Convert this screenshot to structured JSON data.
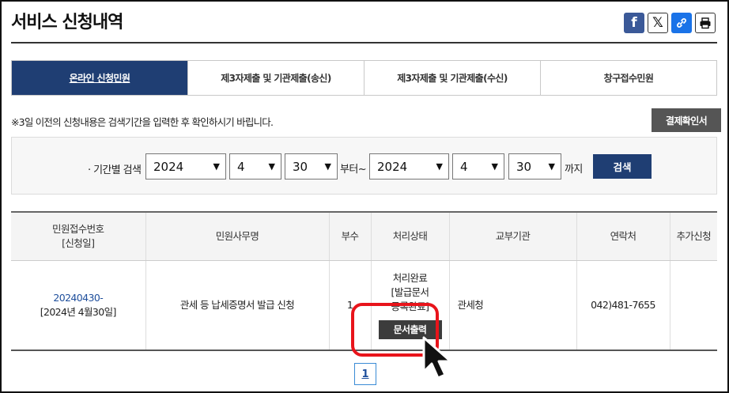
{
  "header": {
    "title": "서비스 신청내역",
    "share_icons": [
      "facebook-icon",
      "x-icon",
      "link-icon",
      "print-icon"
    ],
    "facebook_glyph": "f",
    "x_glyph": "𝕏"
  },
  "tabs": [
    {
      "label": "온라인 신청민원",
      "active": true
    },
    {
      "label": "제3자제출 및 기관제출(송신)",
      "active": false
    },
    {
      "label": "제3자제출 및 기관제출(수신)",
      "active": false
    },
    {
      "label": "창구접수민원",
      "active": false
    }
  ],
  "notice": "※3일 이전의 신청내용은 검색기간을 입력한 후 확인하시기 바립니다.",
  "receipt_button": "결제확인서",
  "search": {
    "label": "· 기간별 검색",
    "from_year": "2024",
    "from_month": "4",
    "from_day": "30",
    "from_suffix": "부터~",
    "to_year": "2024",
    "to_month": "4",
    "to_day": "30",
    "to_suffix": "까지",
    "button": "검색"
  },
  "table": {
    "headers": {
      "receipt_no_line1": "민원접수번호",
      "receipt_no_line2": "[신청일]",
      "service": "민원사무명",
      "copies": "부수",
      "status": "처리상태",
      "issuer": "교부기관",
      "contact": "연락처",
      "extra": "추가신청"
    },
    "rows": [
      {
        "receipt_no": "20240430-",
        "date": "[2024년 4월30일]",
        "service": "관세 등 납세증명서 발급 신청",
        "copies": "1",
        "status_line1": "처리완료",
        "status_line2": "[발급문서",
        "status_line3": "등록완료]",
        "print_button": "문서출력",
        "issuer": "관세청",
        "contact": "042)481-7655",
        "extra": ""
      }
    ]
  },
  "pagination": {
    "current": "1"
  },
  "colors": {
    "primary": "#1f3e73",
    "highlight": "#e8141b"
  }
}
